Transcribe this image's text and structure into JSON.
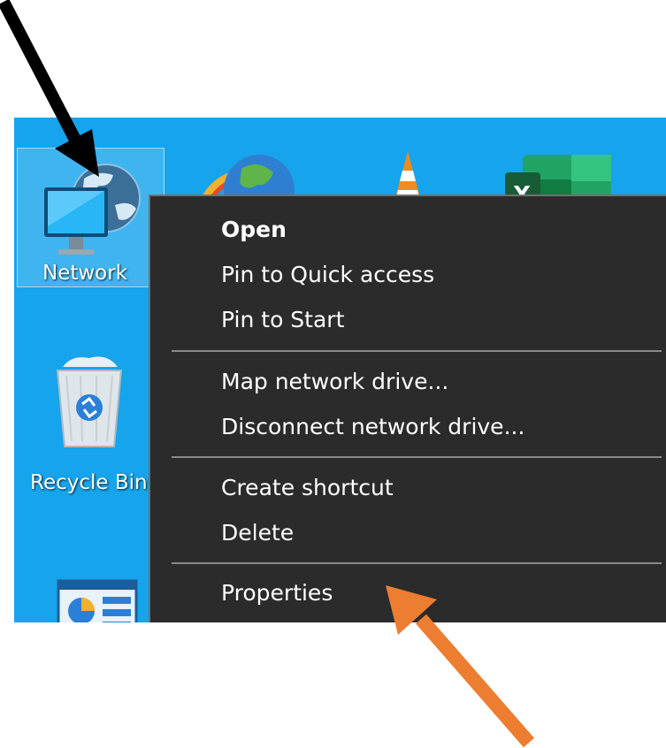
{
  "desktop": {
    "background_color": "#16a4ec",
    "icons": {
      "network": {
        "label": "Network",
        "icon": "network-computer-icon"
      },
      "recycle_bin": {
        "label": "Recycle Bin",
        "icon": "recycle-bin-icon"
      },
      "control_panel": {
        "icon": "control-panel-icon"
      },
      "top_row": [
        "internet-explorer-icon",
        "vlc-cone-icon",
        "excel-icon"
      ]
    }
  },
  "context_menu": {
    "background_color": "#2b2b2b",
    "groups": [
      [
        "Open",
        "Pin to Quick access",
        "Pin to Start"
      ],
      [
        "Map network drive...",
        "Disconnect network drive..."
      ],
      [
        "Create shortcut",
        "Delete"
      ],
      [
        "Properties"
      ]
    ]
  },
  "annotations": {
    "black_arrow": {
      "color": "#000000",
      "points_to": "Network"
    },
    "orange_arrow": {
      "color": "#ed7d31",
      "points_to": "Properties"
    }
  }
}
